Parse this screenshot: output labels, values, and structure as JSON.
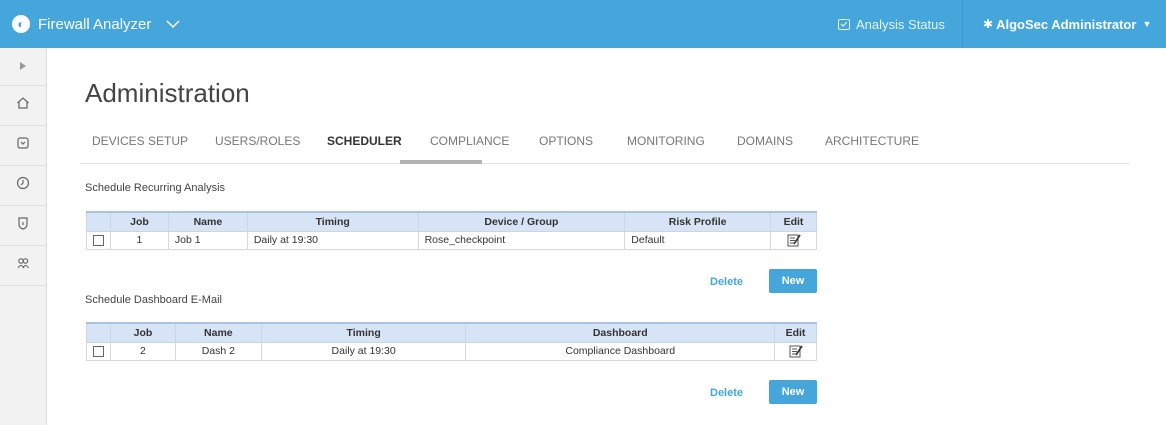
{
  "header": {
    "app_name": "Firewall Analyzer",
    "analysis_status": "Analysis Status",
    "user": "AlgoSec Administrator"
  },
  "sidebar": {
    "items": [
      {
        "icon": "expand-arrow-icon"
      },
      {
        "icon": "home-icon"
      },
      {
        "icon": "device-icon"
      },
      {
        "icon": "clock-icon"
      },
      {
        "icon": "shield-icon"
      },
      {
        "icon": "users-icon"
      }
    ]
  },
  "page": {
    "title": "Administration"
  },
  "tabs": [
    {
      "label": "DEVICES SETUP"
    },
    {
      "label": "USERS/ROLES"
    },
    {
      "label": "SCHEDULER",
      "active": true
    },
    {
      "label": "COMPLIANCE"
    },
    {
      "label": "OPTIONS"
    },
    {
      "label": "MONITORING"
    },
    {
      "label": "DOMAINS"
    },
    {
      "label": "ARCHITECTURE"
    }
  ],
  "recurring": {
    "title": "Schedule Recurring Analysis",
    "columns": [
      "Job",
      "Name",
      "Timing",
      "Device / Group",
      "Risk Profile",
      "Edit"
    ],
    "rows": [
      {
        "job": "1",
        "name": "Job 1",
        "timing": "Daily at 19:30",
        "device": "Rose_checkpoint",
        "risk": "Default"
      }
    ],
    "delete_label": "Delete",
    "new_label": "New"
  },
  "dashboard_email": {
    "title": "Schedule Dashboard E-Mail",
    "columns": [
      "Job",
      "Name",
      "Timing",
      "Dashboard",
      "Edit"
    ],
    "rows": [
      {
        "job": "2",
        "name": "Dash 2",
        "timing": "Daily at 19:30",
        "dashboard": "Compliance Dashboard"
      }
    ],
    "delete_label": "Delete",
    "new_label": "New"
  },
  "colors": {
    "accent": "#45a6dc",
    "table_header": "#d6e4f5"
  }
}
